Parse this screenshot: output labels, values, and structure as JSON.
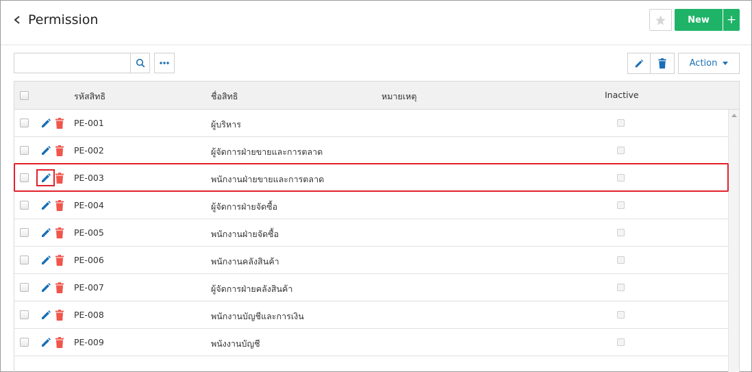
{
  "header": {
    "title": "Permission",
    "new_label": "New",
    "plus_label": "+"
  },
  "toolbar": {
    "search_value": "",
    "search_placeholder": "",
    "action_label": "Action"
  },
  "table": {
    "columns": [
      "รหัสสิทธิ",
      "ชื่อสิทธิ",
      "หมายเหตุ",
      "Inactive"
    ],
    "rows": [
      {
        "code": "PE-001",
        "name": "ผู้บริหาร",
        "note": ""
      },
      {
        "code": "PE-002",
        "name": "ผู้จัดการฝ่ายขายและการตลาด",
        "note": ""
      },
      {
        "code": "PE-003",
        "name": "พนักงานฝ่ายขายและการตลาด",
        "note": ""
      },
      {
        "code": "PE-004",
        "name": "ผู้จัดการฝ่ายจัดซื้อ",
        "note": ""
      },
      {
        "code": "PE-005",
        "name": "พนักงานฝ่ายจัดซื้อ",
        "note": ""
      },
      {
        "code": "PE-006",
        "name": "พนักงานคลังสินค้า",
        "note": ""
      },
      {
        "code": "PE-007",
        "name": "ผู้จัดการฝ่ายคลังสินค้า",
        "note": ""
      },
      {
        "code": "PE-008",
        "name": "พนักงานบัญชีและการเงิน",
        "note": ""
      },
      {
        "code": "PE-009",
        "name": "พนังงานบัญชี",
        "note": ""
      }
    ]
  },
  "colors": {
    "primary": "#1a6fb5",
    "success": "#1fb367",
    "danger": "#f0564c",
    "highlight": "#e0202a"
  },
  "icons": {
    "back": "chevron-left-icon",
    "favorite": "star-icon",
    "search": "search-icon",
    "more": "ellipsis-icon",
    "edit": "pencil-icon",
    "delete": "trash-icon"
  }
}
